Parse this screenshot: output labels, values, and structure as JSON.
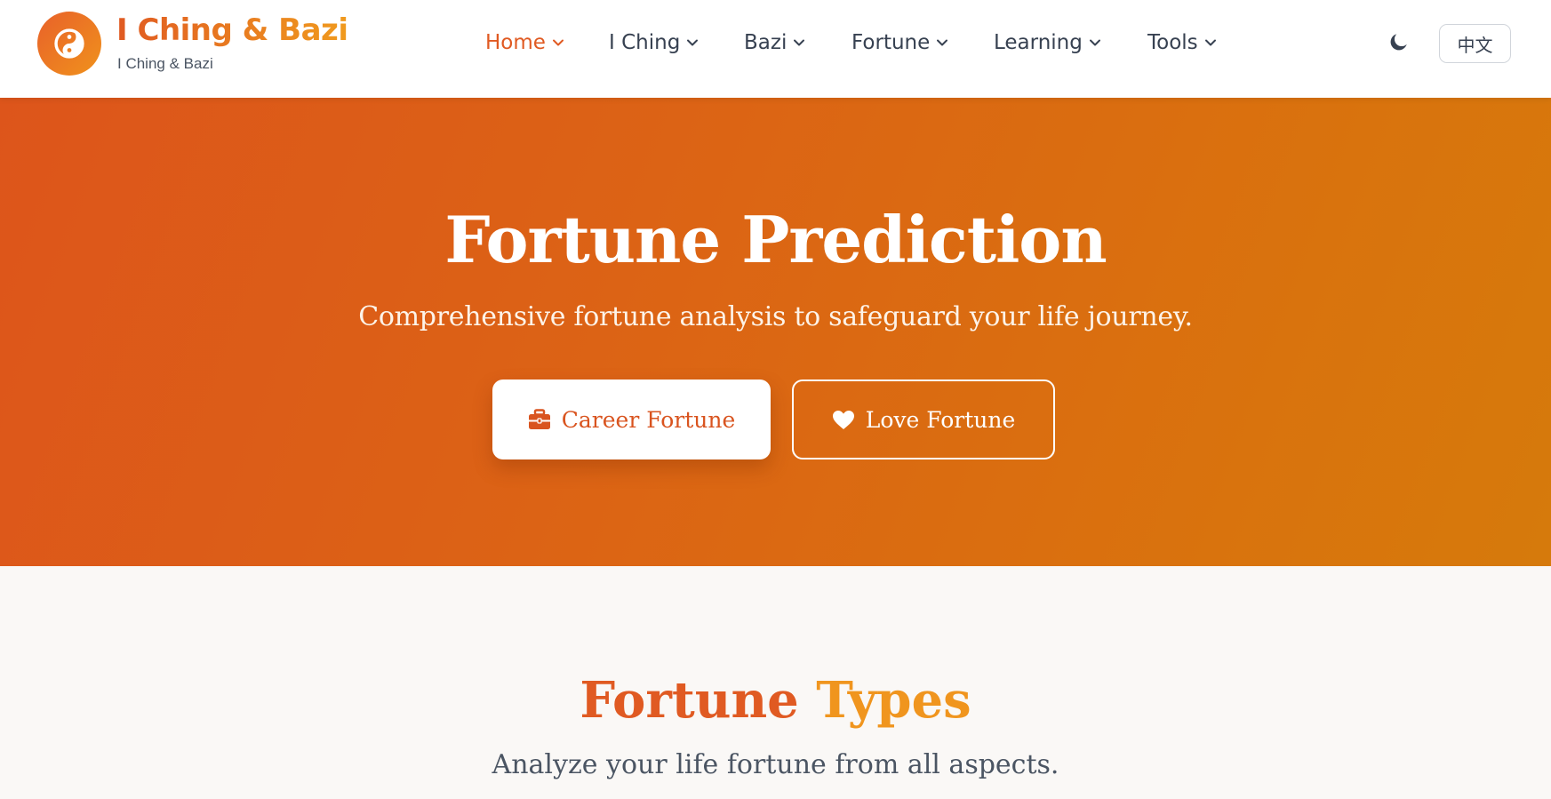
{
  "header": {
    "brand_title": "I Ching & Bazi",
    "brand_subtitle": "I Ching & Bazi",
    "logo_icon": "yin-yang-icon",
    "nav": [
      {
        "label": "Home",
        "active": true
      },
      {
        "label": "I Ching",
        "active": false
      },
      {
        "label": "Bazi",
        "active": false
      },
      {
        "label": "Fortune",
        "active": false
      },
      {
        "label": "Learning",
        "active": false
      },
      {
        "label": "Tools",
        "active": false
      }
    ],
    "theme_icon": "moon-icon",
    "language_button": "中文"
  },
  "hero": {
    "title": "Fortune Prediction",
    "subtitle": "Comprehensive fortune analysis to safeguard your life journey.",
    "primary_button": {
      "label": "Career Fortune",
      "icon": "briefcase-icon"
    },
    "secondary_button": {
      "label": "Love Fortune",
      "icon": "heart-icon"
    }
  },
  "section": {
    "title_part1": "Fortune ",
    "title_part2": "Types",
    "subtitle": "Analyze your life fortune from all aspects."
  },
  "colors": {
    "accent": "#e05a22",
    "accent_light": "#f0951e",
    "hero_gradient_start": "#dd551b",
    "hero_gradient_end": "#d67a0c",
    "text_dark": "#374151"
  }
}
